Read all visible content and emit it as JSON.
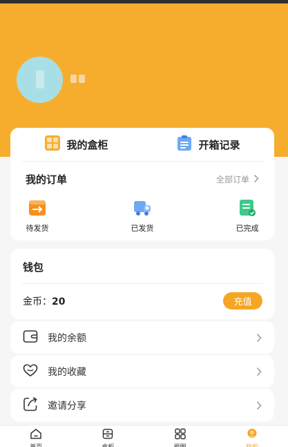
{
  "profile": {
    "username": ""
  },
  "tabs": [
    {
      "label": "我的盒柜",
      "icon": "box-cabinet-icon"
    },
    {
      "label": "开箱记录",
      "icon": "clipboard-icon"
    }
  ],
  "orders": {
    "title": "我的订单",
    "all_label": "全部订单",
    "statuses": [
      {
        "label": "待发货",
        "icon": "pending-shipment-icon"
      },
      {
        "label": "已发货",
        "icon": "truck-icon"
      },
      {
        "label": "已完成",
        "icon": "completed-icon"
      }
    ]
  },
  "wallet": {
    "title": "钱包",
    "coins_label": "金币：",
    "coins_value": "20",
    "recharge_label": "充值"
  },
  "menu": [
    {
      "label": "我的余额",
      "icon": "wallet-icon"
    },
    {
      "label": "我的收藏",
      "icon": "heart-icon"
    },
    {
      "label": "邀请分享",
      "icon": "share-icon"
    }
  ],
  "tabbar": [
    {
      "label": "首页",
      "icon": "home-icon"
    },
    {
      "label": "盒柜",
      "icon": "cabinet-icon"
    },
    {
      "label": "题图",
      "icon": "grid-icon"
    },
    {
      "label": "我的",
      "icon": "user-icon",
      "active": true
    }
  ],
  "colors": {
    "accent": "#f6ad2e",
    "recharge": "#f5a623"
  }
}
